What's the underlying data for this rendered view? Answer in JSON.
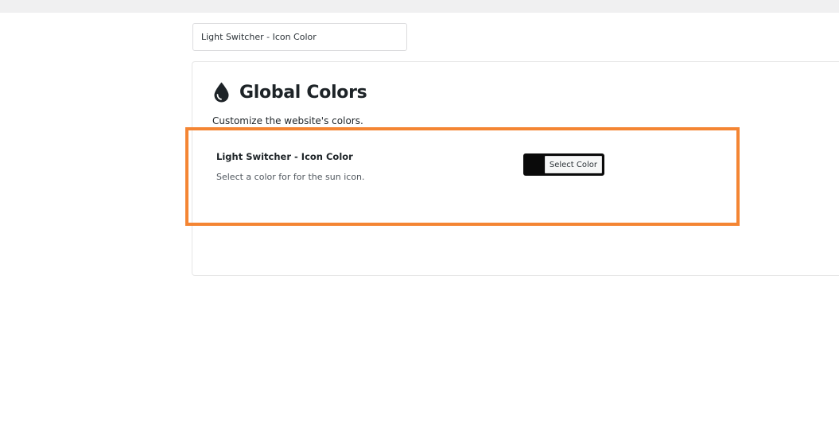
{
  "search": {
    "value": "Light Switcher - Icon Color"
  },
  "panel": {
    "icon": "drop-icon",
    "title": "Global Colors",
    "subtitle": "Customize the website's colors."
  },
  "setting": {
    "label": "Light Switcher - Icon Color",
    "description": "Select a color for for the sun icon.",
    "current_color": "#0a0a0a",
    "button_label": "Select Color"
  },
  "colors": {
    "highlight": "#f48533",
    "topbar": "#f0f0f1"
  }
}
